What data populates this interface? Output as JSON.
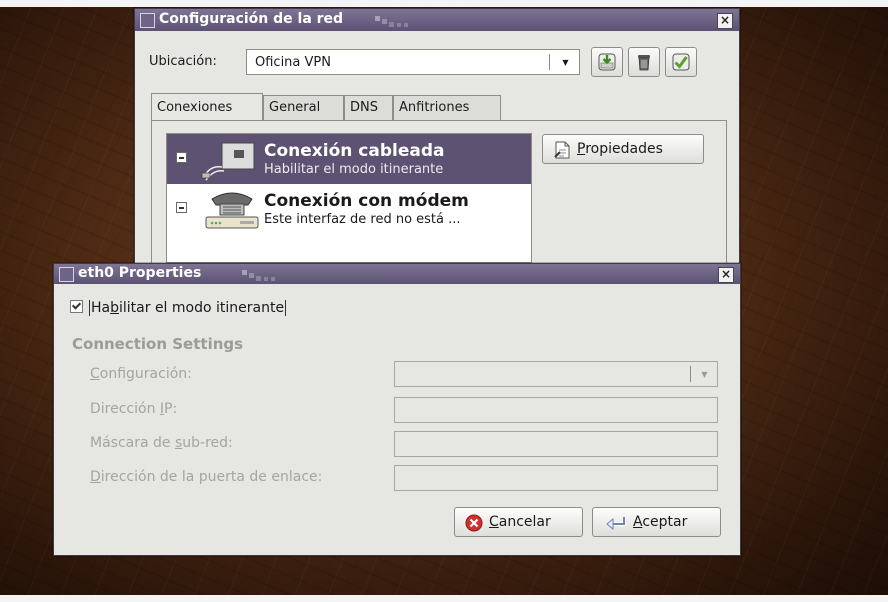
{
  "network_window": {
    "title": "Configuración de la red",
    "location_label": "Ubicación:",
    "location_value": "Oficina VPN",
    "toolbar_icons": [
      "save-location-icon",
      "delete-location-icon",
      "apply-location-icon"
    ],
    "tabs": [
      {
        "label": "Conexiones",
        "active": true
      },
      {
        "label": "General",
        "active": false
      },
      {
        "label": "DNS",
        "active": false
      },
      {
        "label": "Anfitriones",
        "active": false
      }
    ],
    "connections": [
      {
        "name": "Conexión cableada",
        "description": "Habilitar el modo itinerante",
        "icon": "wired-network-icon",
        "selected": true
      },
      {
        "name": "Conexión con módem",
        "description": "Este interfaz de red no está ...",
        "icon": "modem-phone-icon",
        "selected": false
      }
    ],
    "properties_button": {
      "mnemonic": "P",
      "rest": "ropiedades",
      "icon": "properties-icon"
    }
  },
  "properties_dialog": {
    "title": "eth0 Properties",
    "roaming_checkbox": {
      "before": "Ha",
      "mnemonic": "b",
      "after": "ilitar el modo itinerante",
      "checked": true
    },
    "section_title": "Connection Settings",
    "fields": [
      {
        "before": "",
        "mnemonic": "C",
        "after": "onfiguración:"
      },
      {
        "before": "Dirección ",
        "mnemonic": "I",
        "after": "P:"
      },
      {
        "before": "Máscara de ",
        "mnemonic": "s",
        "after": "ub-red:"
      },
      {
        "before": "",
        "mnemonic": "D",
        "after": "irección de la puerta de enlace:"
      }
    ],
    "cancel_button": {
      "mnemonic": "C",
      "rest": "ancelar",
      "icon": "cancel-icon"
    },
    "accept_button": {
      "mnemonic": "A",
      "rest": "ceptar",
      "icon": "accept-icon"
    }
  },
  "colors": {
    "titlebar": "#5d5273",
    "selection": "#5e5273",
    "cancel_icon": "#d0312d",
    "apply_icon": "#5aa02c"
  }
}
